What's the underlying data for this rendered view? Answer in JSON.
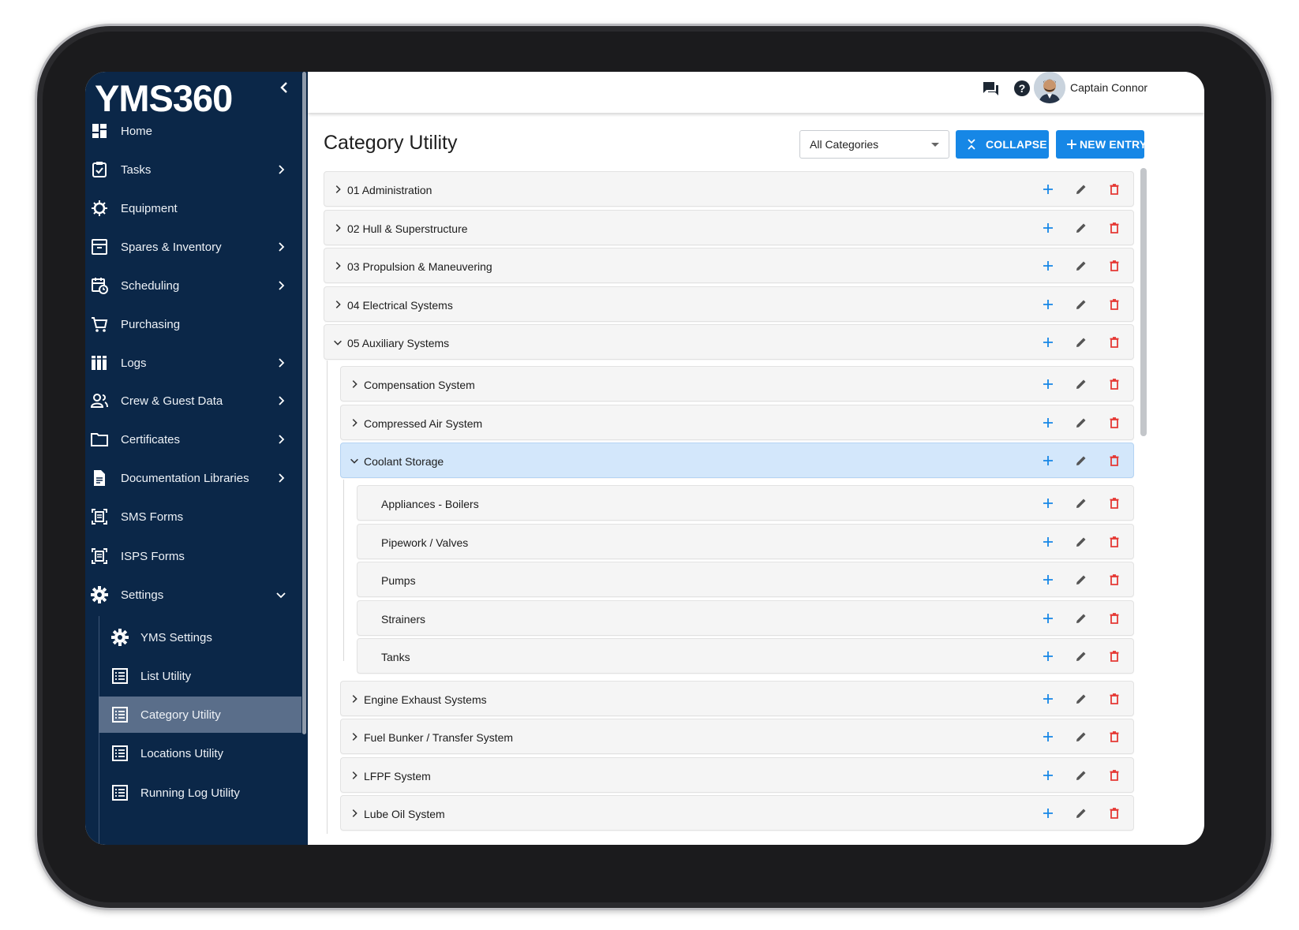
{
  "app": {
    "logo": "YMS360"
  },
  "user": {
    "name": "Captain Connor"
  },
  "sidebar": {
    "items": [
      {
        "label": "Home",
        "icon": "dashboard-icon",
        "has_submenu": false
      },
      {
        "label": "Tasks",
        "icon": "clipboard-check-icon",
        "has_submenu": true
      },
      {
        "label": "Equipment",
        "icon": "tools-icon",
        "has_submenu": false
      },
      {
        "label": "Spares & Inventory",
        "icon": "inventory-box-icon",
        "has_submenu": true
      },
      {
        "label": "Scheduling",
        "icon": "calendar-clock-icon",
        "has_submenu": true
      },
      {
        "label": "Purchasing",
        "icon": "cart-icon",
        "has_submenu": false
      },
      {
        "label": "Logs",
        "icon": "books-icon",
        "has_submenu": true
      },
      {
        "label": "Crew & Guest Data",
        "icon": "people-icon",
        "has_submenu": true
      },
      {
        "label": "Certificates",
        "icon": "folder-icon",
        "has_submenu": true
      },
      {
        "label": "Documentation Libraries",
        "icon": "document-icon",
        "has_submenu": true
      },
      {
        "label": "SMS Forms",
        "icon": "form-icon",
        "has_submenu": false
      },
      {
        "label": "ISPS Forms",
        "icon": "form-icon",
        "has_submenu": false
      },
      {
        "label": "Settings",
        "icon": "gear-icon",
        "has_submenu": true,
        "expanded": true
      }
    ],
    "settings_items": [
      {
        "label": "YMS Settings",
        "icon": "gear-icon"
      },
      {
        "label": "List Utility",
        "icon": "list-icon"
      },
      {
        "label": "Category Utility",
        "icon": "list-icon",
        "active": true
      },
      {
        "label": "Locations Utility",
        "icon": "list-icon"
      },
      {
        "label": "Running Log Utility",
        "icon": "list-icon"
      }
    ]
  },
  "page": {
    "title": "Category Utility",
    "filter": {
      "selected": "All Categories"
    },
    "collapse_label": "COLLAPSE",
    "new_entry_label": "NEW ENTRY"
  },
  "tree": [
    {
      "label": "01 Administration",
      "level": 0,
      "expanded": false
    },
    {
      "label": "02 Hull & Superstructure",
      "level": 0,
      "expanded": false
    },
    {
      "label": "03 Propulsion & Maneuvering",
      "level": 0,
      "expanded": false
    },
    {
      "label": "04 Electrical Systems",
      "level": 0,
      "expanded": false
    },
    {
      "label": "05 Auxiliary Systems",
      "level": 0,
      "expanded": true
    },
    {
      "label": "Compensation System",
      "level": 1,
      "expanded": false
    },
    {
      "label": "Compressed Air System",
      "level": 1,
      "expanded": false
    },
    {
      "label": "Coolant Storage",
      "level": 1,
      "expanded": true,
      "selected": true
    },
    {
      "label": "Appliances - Boilers",
      "level": 2,
      "leaf": true
    },
    {
      "label": "Pipework / Valves",
      "level": 2,
      "leaf": true
    },
    {
      "label": "Pumps",
      "level": 2,
      "leaf": true
    },
    {
      "label": "Strainers",
      "level": 2,
      "leaf": true
    },
    {
      "label": "Tanks",
      "level": 2,
      "leaf": true
    },
    {
      "label": "Engine Exhaust Systems",
      "level": 1,
      "expanded": false
    },
    {
      "label": "Fuel Bunker / Transfer System",
      "level": 1,
      "expanded": false
    },
    {
      "label": "LFPF System",
      "level": 1,
      "expanded": false
    },
    {
      "label": "Lube Oil System",
      "level": 1,
      "expanded": false
    }
  ],
  "colors": {
    "sidebar": "#0b2748",
    "accent": "#1687e6",
    "delete": "#e53935",
    "add": "#1687e6",
    "edit": "#555555",
    "selected_row": "#d3e7fb"
  }
}
